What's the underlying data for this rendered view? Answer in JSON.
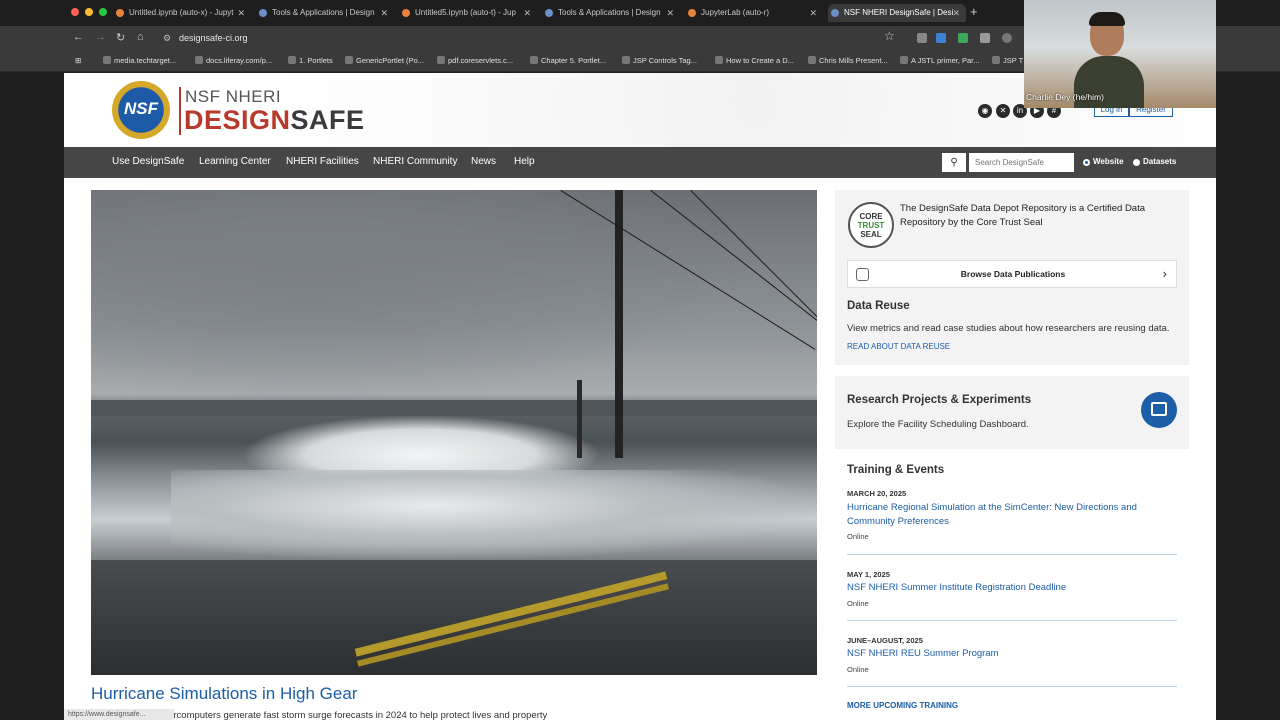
{
  "browser": {
    "tabs": [
      {
        "title": "Untitled.ipynb (auto-x) - Jupyt",
        "color": "#e8843a"
      },
      {
        "title": "Tools & Applications | Design",
        "color": "#6b8fc7"
      },
      {
        "title": "Untitled5.ipynb (auto-t) - Jup",
        "color": "#e8843a"
      },
      {
        "title": "Tools & Applications | Design",
        "color": "#6b8fc7"
      },
      {
        "title": "JupyterLab (auto-r)",
        "color": "#e8843a"
      },
      {
        "title": "NSF NHERI DesignSafe | Desi",
        "color": "#6b8fc7"
      }
    ],
    "url": "designsafe-ci.org",
    "bookmarks": [
      "media.techtarget...",
      "docs.liferay.com/p...",
      "1. Portlets",
      "GenericPortlet (Po...",
      "pdf.coreservlets.c...",
      "Chapter 5. Portlet...",
      "JSP Controls Tag...",
      "How to Create a D...",
      "Chris Mills Present...",
      "A JSTL primer, Par...",
      "JSP T"
    ]
  },
  "header": {
    "logo_top": "NSF NHERI",
    "logo_design": "DESIGN",
    "logo_safe": "SAFE",
    "seal_text": "NSF",
    "login": "Log in",
    "register": "Register"
  },
  "nav": {
    "items": [
      "Use DesignSafe",
      "Learning Center",
      "NHERI Facilities",
      "NHERI Community",
      "News",
      "Help"
    ],
    "search_placeholder": "Search DesignSafe",
    "radio_website": "Website",
    "radio_datasets": "Datasets"
  },
  "hero": {
    "title": "Hurricane Simulations in High Gear",
    "text": "Scientists and supercomputers generate fast storm surge forecasts in 2024 to help protect lives and property"
  },
  "data_depot": {
    "seal_lines": [
      "CORE",
      "TRUST",
      "SEAL"
    ],
    "text": "The DesignSafe Data Depot Repository is a Certified Data Repository by the Core Trust Seal",
    "browse_label": "Browse Data Publications",
    "reuse_heading": "Data Reuse",
    "reuse_text": "View metrics and read case studies about how researchers are reusing data.",
    "reuse_link": "READ ABOUT DATA REUSE"
  },
  "research": {
    "heading": "Research Projects & Experiments",
    "text": "Explore the Facility Scheduling Dashboard."
  },
  "training": {
    "heading": "Training & Events",
    "events": [
      {
        "date": "MARCH 20, 2025",
        "title": "Hurricane Regional Simulation at the SimCenter: New Directions and Community Preferences",
        "mode": "Online"
      },
      {
        "date": "MAY 1, 2025",
        "title": "NSF NHERI Summer Institute Registration Deadline",
        "mode": "Online"
      },
      {
        "date": "JUNE–AUGUST, 2025",
        "title": "NSF NHERI REU Summer Program",
        "mode": "Online"
      }
    ],
    "more": "MORE UPCOMING TRAINING"
  },
  "video": {
    "name": "Charlie Dey (he/him)"
  },
  "status_url": "https://www.designsafe..."
}
